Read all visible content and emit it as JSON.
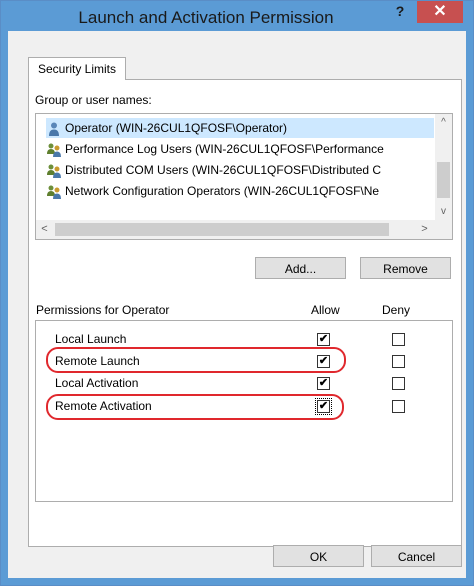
{
  "window": {
    "title": "Launch and Activation Permission",
    "help_glyph": "?",
    "close_glyph": "✕"
  },
  "tab": {
    "label": "Security Limits"
  },
  "group_section": {
    "label": "Group or user names:",
    "items": [
      {
        "name": "Operator (WIN-26CUL1QFOSF\\Operator)",
        "icon": "single-user-icon"
      },
      {
        "name": "Performance Log Users (WIN-26CUL1QFOSF\\Performance",
        "icon": "user-group-icon"
      },
      {
        "name": "Distributed COM Users (WIN-26CUL1QFOSF\\Distributed C",
        "icon": "user-group-icon"
      },
      {
        "name": "Network Configuration Operators (WIN-26CUL1QFOSF\\Ne",
        "icon": "user-group-icon"
      }
    ],
    "scroll_up": "^",
    "scroll_down": "v",
    "scroll_left": "<",
    "scroll_right": ">",
    "add_label": "Add...",
    "remove_label": "Remove"
  },
  "permissions": {
    "label": "Permissions for Operator",
    "allow_header": "Allow",
    "deny_header": "Deny",
    "rows": [
      {
        "name": "Local Launch",
        "allow": true,
        "deny": false,
        "highlighted": false
      },
      {
        "name": "Remote Launch",
        "allow": true,
        "deny": false,
        "highlighted": true
      },
      {
        "name": "Local Activation",
        "allow": true,
        "deny": false,
        "highlighted": false
      },
      {
        "name": "Remote Activation",
        "allow": true,
        "deny": false,
        "highlighted": true
      }
    ]
  },
  "footer": {
    "ok_label": "OK",
    "cancel_label": "Cancel"
  },
  "colors": {
    "highlight": "#e0282d",
    "titlebar": "#5b9bd5",
    "close": "#c75050"
  }
}
